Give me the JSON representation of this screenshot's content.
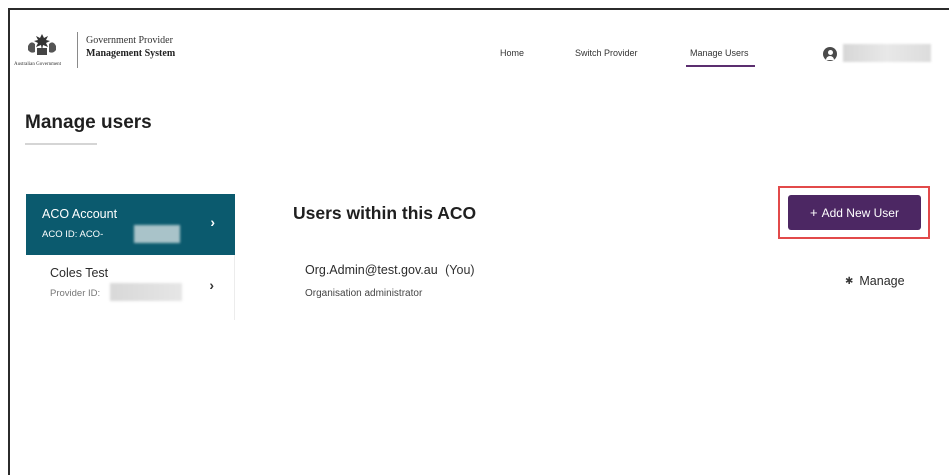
{
  "header": {
    "crest_caption": "Australian Government",
    "app_title_line1": "Government Provider",
    "app_title_line2": "Management System",
    "nav": {
      "home": "Home",
      "switch_provider": "Switch Provider",
      "manage_users": "Manage Users"
    },
    "active_nav": "Manage Users",
    "user_icon": "user-circle-icon"
  },
  "page": {
    "title": "Manage users"
  },
  "sidebar": {
    "items": [
      {
        "title": "ACO Account",
        "id_label": "ACO ID: ACO-",
        "active": true,
        "icon": "chevron-right-icon"
      },
      {
        "title": "Coles Test",
        "id_label": "Provider ID:",
        "active": false,
        "icon": "chevron-right-icon"
      }
    ]
  },
  "main": {
    "section_title": "Users within this ACO",
    "add_button": {
      "icon": "+",
      "label": "Add New User"
    },
    "users": [
      {
        "email": "Org.Admin@test.gov.au",
        "tag": "(You)",
        "role": "Organisation administrator",
        "action_label": "Manage",
        "action_icon": "gear-icon"
      }
    ]
  },
  "colors": {
    "accent_purple": "#4c2763",
    "sidebar_active": "#0b5a6e",
    "highlight_box": "#e24a4a",
    "nav_underline": "#5b2e6f"
  }
}
